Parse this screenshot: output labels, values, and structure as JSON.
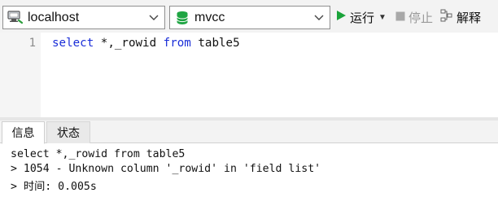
{
  "toolbar": {
    "connection": {
      "value": "localhost",
      "icon": "connection-icon"
    },
    "database": {
      "value": "mvcc",
      "icon": "database-icon"
    },
    "run_label": "运行",
    "stop_label": "停止",
    "explain_label": "解释",
    "colors": {
      "run": "#1aa33a",
      "database": "#1fa543",
      "disabled": "#9a9a9a"
    }
  },
  "editor": {
    "line_number": "1",
    "query": {
      "kw_select": "select",
      "columns": " *,_rowid ",
      "kw_from": "from",
      "table": " table5"
    },
    "keyword_color": "#1a2ed8"
  },
  "tabs": [
    {
      "label": "信息",
      "active": true
    },
    {
      "label": "状态",
      "active": false
    }
  ],
  "output": {
    "lines": [
      "select *,_rowid from table5",
      "> 1054 - Unknown column '_rowid' in 'field list'",
      "> 时间: 0.005s"
    ]
  }
}
